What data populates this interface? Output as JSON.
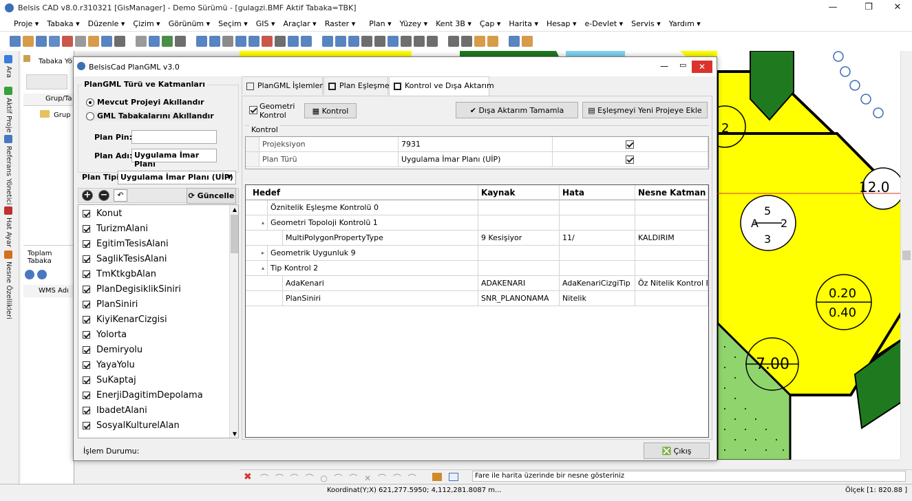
{
  "window": {
    "title": "Belsis CAD v8.0.r310321 [GisManager] - Demo Sürümü - [gulagzi.BMF  Aktif Tabaka=TBK]"
  },
  "menu": [
    "Proje ▾",
    "Tabaka ▾",
    "Düzenle ▾",
    "Çizim ▾",
    "Görünüm ▾",
    "Seçim ▾",
    "GIS ▾",
    "Araçlar ▾",
    "Raster ▾",
    "Plan ▾",
    "Yüzey ▾",
    "Kent 3B ▾",
    "Çap ▾",
    "Harita ▾",
    "Hesap ▾",
    "e-Devlet ▾",
    "Servis ▾",
    "Yardım ▾"
  ],
  "sidetabs": [
    "Ara",
    "Aktif Proje",
    "Referans Yönetici",
    "Hat Ayar",
    "Nesne Özellikleri"
  ],
  "layerpanel": {
    "title": "Tabaka Yö",
    "col": "Grup/Ta",
    "group": "Grup",
    "footer": "Toplam Tabaka",
    "wms": "WMS Adı"
  },
  "dialog": {
    "title": "BelsisCad PlanGML v3.0",
    "left": {
      "group_title": "PlanGML Türü ve Katmanları",
      "radio1": "Mevcut Projeyi Akıllandır",
      "radio2": "GML Tabakalarını Akıllandır",
      "plan_pin_label": "Plan Pin:",
      "plan_pin_value": "",
      "plan_adi_label": "Plan Adı:",
      "plan_adi_value": "Uygulama İmar Planı",
      "plan_tipi_label": "Plan Tipi:",
      "plan_tipi_value": "Uygulama İmar Planı (UİP)",
      "guncelle": "Güncelle",
      "layers": [
        "Konut",
        "TurizmAlani",
        "EgitimTesisAlani",
        "SaglikTesisAlani",
        "TmKtkgbAlan",
        "PlanDegisiklikSiniri",
        "PlanSiniri",
        "KiyiKenarCizgisi",
        "Yolorta",
        "Demiryolu",
        "YayaYolu",
        "SuKaptaj",
        "EnerjiDagitimDepolama",
        "IbadetAlani",
        "SosyalKulturelAlan"
      ]
    },
    "tabs": [
      "PlanGML İşlemleri",
      "Plan Eşleşme",
      "Kontrol ve Dışa Aktarım"
    ],
    "geometri_kontrol": "Geometri Kontrol",
    "kontrol_btn": "Kontrol",
    "disa_aktarim_btn": "Dışa Aktarım Tamamla",
    "eslesme_btn": "Eşleşmeyi Yeni Projeye Ekle",
    "kontrol_group": "Kontrol",
    "props": [
      {
        "k": "Projeksiyon",
        "v": "7931"
      },
      {
        "k": "Plan Türü",
        "v": "Uygulama İmar Planı (UİP)"
      }
    ],
    "headers": [
      "Hedef",
      "Kaynak",
      "Hata",
      "Nesne Katman"
    ],
    "rows": [
      {
        "h": "Öznitelik Eşleşme Kontrolü 0",
        "k": "",
        "e": "",
        "n": ""
      },
      {
        "h": "Geometri Topoloji Kontrolü 1",
        "k": "",
        "e": "",
        "n": ""
      },
      {
        "h": "MultiPolygonPropertyType",
        "k": "9 Kesişiyor",
        "e": "11/",
        "n": "KALDIRIM"
      },
      {
        "h": "Geometrik Uygunluk 9",
        "k": "",
        "e": "",
        "n": ""
      },
      {
        "h": "Tip Kontrol 2",
        "k": "",
        "e": "",
        "n": ""
      },
      {
        "h": "AdaKenari",
        "k": "ADAKENARI",
        "e": "AdaKenariCizgiTip",
        "n": "Öz Nitelik Kontrol Edir"
      },
      {
        "h": "PlanSiniri",
        "k": "SNR_PLANONAMA",
        "e": "Nitelik",
        "n": ""
      }
    ],
    "islem_durumu": "İşlem Durumu:",
    "cikis": "Çıkış"
  },
  "map": {
    "labels": [
      "5",
      "2",
      "12.0",
      "A",
      "5",
      "2",
      "3",
      "0.20",
      "0.40",
      "7.00",
      "0.40"
    ]
  },
  "bottom_hint": "Fare ile harita üzerinde bir nesne gösteriniz",
  "status": {
    "coord": "Koordinat(Y;X)  621,277.5950; 4,112,281.8087 m...",
    "scale": "Ölçek [1: 820.88 ]"
  },
  "colors": {
    "yellow": "#ffff00",
    "green": "#8fd46c",
    "darkgreen": "#1f7a1f",
    "accent": "#d9332b"
  }
}
